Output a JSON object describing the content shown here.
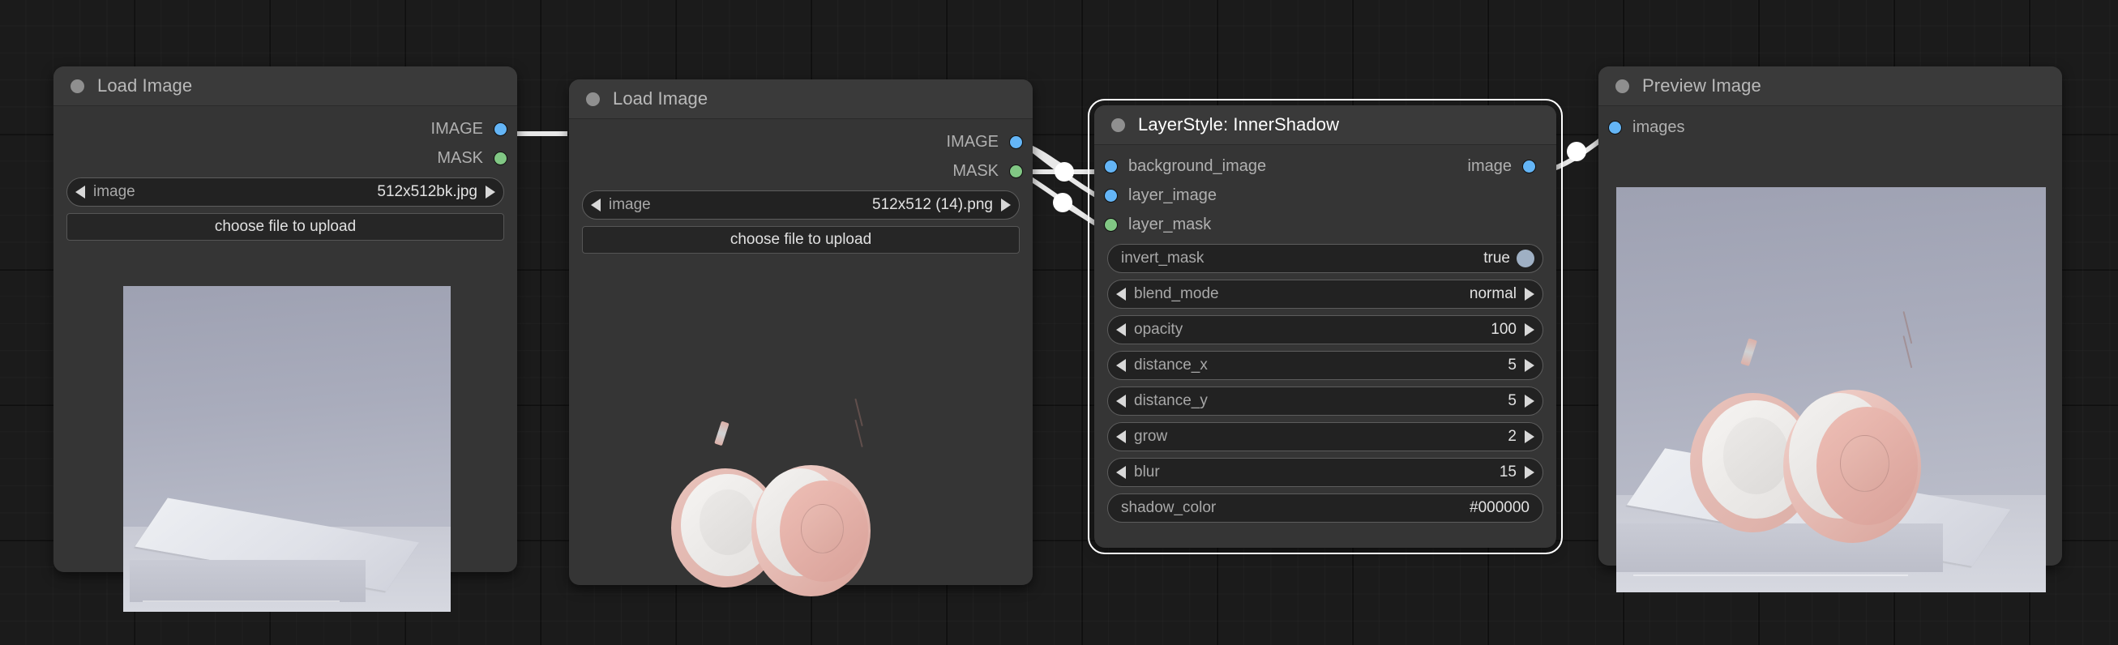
{
  "app": {
    "canvas_background": "#1b1b1b",
    "grid_color": "#262626"
  },
  "colors": {
    "image_slot": "#64b5f6",
    "mask_slot": "#81c784",
    "node_background": "#353535",
    "node_title_background": "#3a3a3a",
    "widget_background": "#222222",
    "selection_outline": "#ffffff"
  },
  "nodes": [
    {
      "id": "load-image-1",
      "title": "Load Image",
      "selected": false,
      "outputs": [
        {
          "label": "IMAGE",
          "type": "image"
        },
        {
          "label": "MASK",
          "type": "mask"
        }
      ],
      "widgets": [
        {
          "kind": "combo",
          "label": "image",
          "value": "512x512bk.jpg"
        },
        {
          "kind": "button",
          "label": "choose file to upload"
        }
      ],
      "preview": "podium-scene"
    },
    {
      "id": "load-image-2",
      "title": "Load Image",
      "selected": false,
      "outputs": [
        {
          "label": "IMAGE",
          "type": "image"
        },
        {
          "label": "MASK",
          "type": "mask"
        }
      ],
      "widgets": [
        {
          "kind": "combo",
          "label": "image",
          "value": "512x512 (14).png"
        },
        {
          "kind": "button",
          "label": "choose file to upload"
        }
      ],
      "preview": "headphones-transparent"
    },
    {
      "id": "layerstyle-innershadow",
      "title": "LayerStyle: InnerShadow",
      "selected": true,
      "inputs": [
        {
          "label": "background_image",
          "type": "image"
        },
        {
          "label": "layer_image",
          "type": "image"
        },
        {
          "label": "layer_mask",
          "type": "mask"
        }
      ],
      "outputs": [
        {
          "label": "image",
          "type": "image"
        }
      ],
      "widgets": [
        {
          "kind": "toggle",
          "label": "invert_mask",
          "value": "true"
        },
        {
          "kind": "combo",
          "label": "blend_mode",
          "value": "normal"
        },
        {
          "kind": "number",
          "label": "opacity",
          "value": "100"
        },
        {
          "kind": "number",
          "label": "distance_x",
          "value": "5"
        },
        {
          "kind": "number",
          "label": "distance_y",
          "value": "5"
        },
        {
          "kind": "number",
          "label": "grow",
          "value": "2"
        },
        {
          "kind": "number",
          "label": "blur",
          "value": "15"
        },
        {
          "kind": "text",
          "label": "shadow_color",
          "value": "#000000"
        }
      ]
    },
    {
      "id": "preview-image",
      "title": "Preview Image",
      "selected": false,
      "inputs": [
        {
          "label": "images",
          "type": "image"
        }
      ],
      "widgets": [],
      "preview": "composited-result"
    }
  ]
}
